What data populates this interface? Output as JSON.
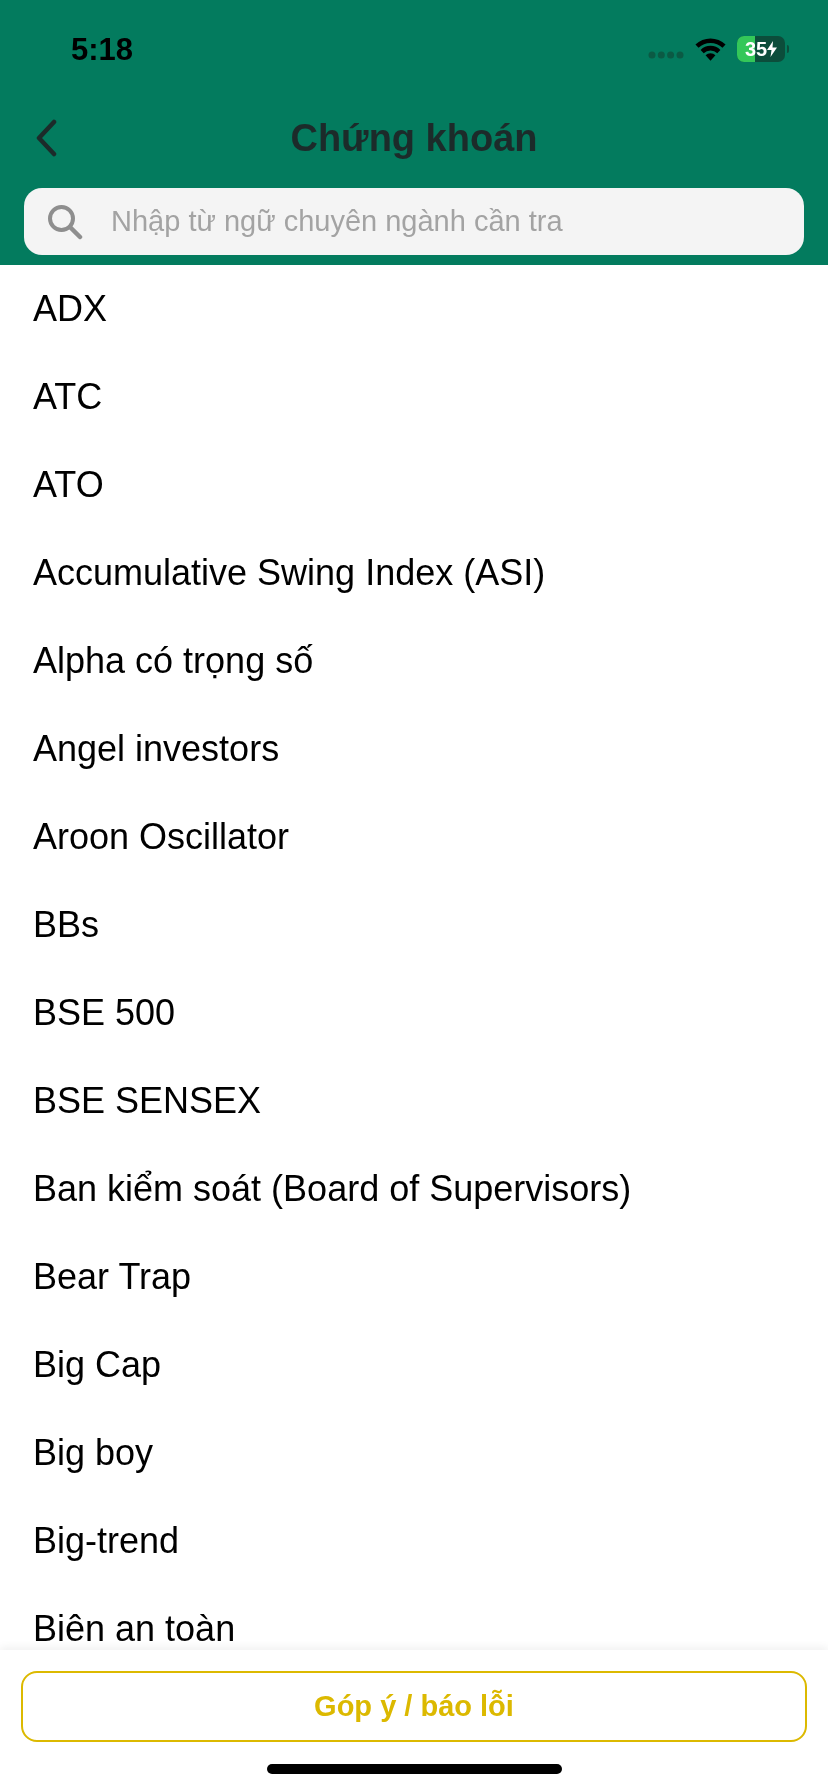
{
  "status_bar": {
    "time": "5:18",
    "battery": "35"
  },
  "nav": {
    "title": "Chứng khoán"
  },
  "search": {
    "placeholder": "Nhập từ ngữ chuyên ngành cần tra"
  },
  "terms": [
    "ADX",
    "ATC",
    "ATO",
    "Accumulative Swing Index (ASI)",
    "Alpha có trọng số",
    "Angel investors",
    "Aroon Oscillator",
    "BBs",
    "BSE 500",
    "BSE SENSEX",
    "Ban kiểm soát (Board of Supervisors)",
    "Bear Trap",
    "Big Cap",
    "Big boy",
    "Big-trend",
    "Biên an toàn"
  ],
  "feedback_button": {
    "label": "Góp ý / báo lỗi"
  }
}
